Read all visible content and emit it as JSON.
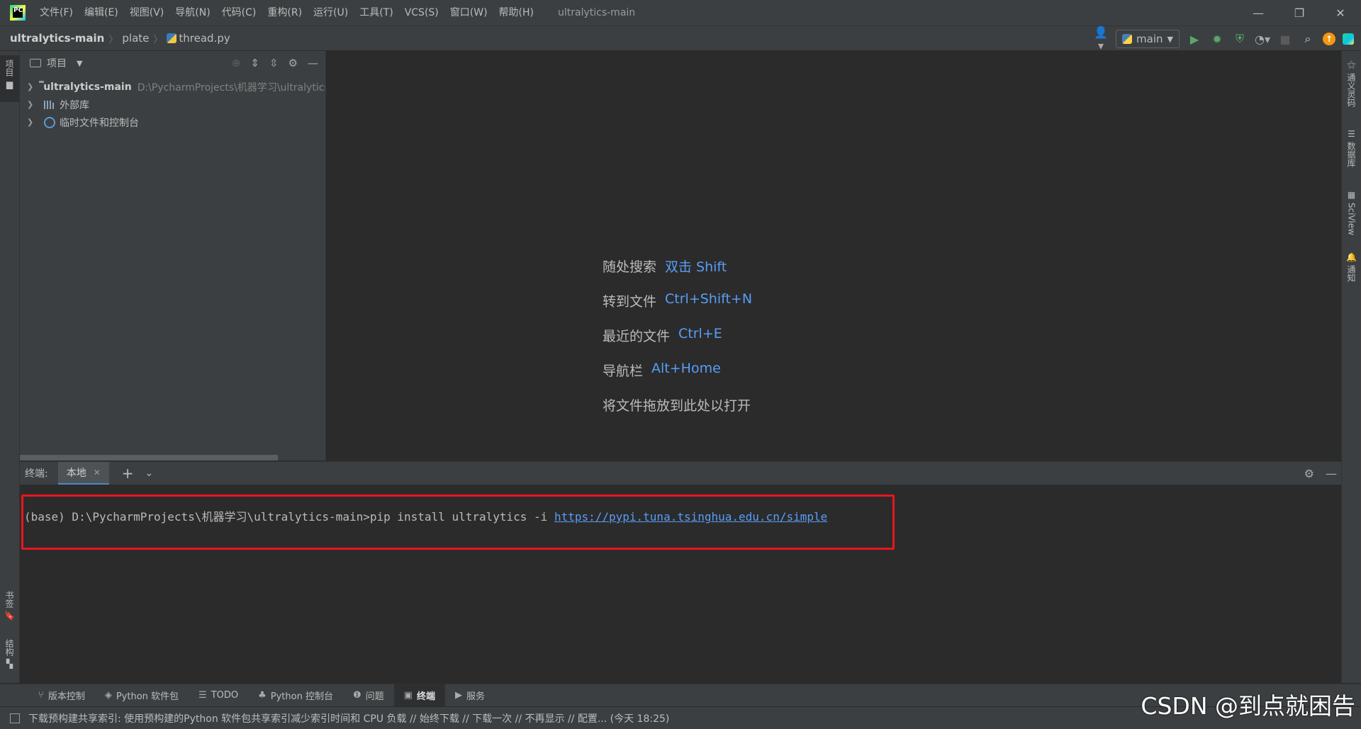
{
  "titlebar": {
    "menu": [
      "文件(F)",
      "编辑(E)",
      "视图(V)",
      "导航(N)",
      "代码(C)",
      "重构(R)",
      "运行(U)",
      "工具(T)",
      "VCS(S)",
      "窗口(W)",
      "帮助(H)"
    ],
    "window_title": "ultralytics-main",
    "minimize": "—",
    "restore": "❐",
    "close": "✕"
  },
  "breadcrumbs": [
    "ultralytics-main",
    "plate",
    "thread.py"
  ],
  "run_config": {
    "label": "main"
  },
  "left_stripe": {
    "project": "项目",
    "bookmarks": "书签",
    "structure": "结构"
  },
  "right_stripe": [
    "通义灵码",
    "数据库",
    "SciView",
    "通知"
  ],
  "project_panel": {
    "title": "项目",
    "tree": [
      {
        "label": "ultralytics-main",
        "path": "D:\\PycharmProjects\\机器学习\\ultralytics-main",
        "icon": "folder-icon"
      },
      {
        "label": "外部库",
        "icon": "library-icon"
      },
      {
        "label": "临时文件和控制台",
        "icon": "scratch-icon"
      }
    ]
  },
  "editor_hints": [
    {
      "label": "随处搜索",
      "key": "双击 Shift"
    },
    {
      "label": "转到文件",
      "key": "Ctrl+Shift+N"
    },
    {
      "label": "最近的文件",
      "key": "Ctrl+E"
    },
    {
      "label": "导航栏",
      "key": "Alt+Home"
    },
    {
      "label": "将文件拖放到此处以打开",
      "key": ""
    }
  ],
  "terminal": {
    "caption": "终端:",
    "tab": "本地",
    "command": "(base) D:\\PycharmProjects\\机器学习\\ultralytics-main>pip install ultralytics -i ",
    "link": "https://pypi.tuna.tsinghua.edu.cn/simple"
  },
  "tool_windows": [
    {
      "label": "版本控制",
      "icon": "branch-icon"
    },
    {
      "label": "Python 软件包",
      "icon": "packages-icon"
    },
    {
      "label": "TODO",
      "icon": "list-icon"
    },
    {
      "label": "Python 控制台",
      "icon": "python-icon"
    },
    {
      "label": "问题",
      "icon": "problems-icon"
    },
    {
      "label": "终端",
      "icon": "terminal-icon",
      "active": true
    },
    {
      "label": "服务",
      "icon": "services-icon"
    }
  ],
  "status": {
    "message": "下载预构建共享索引: 使用预构建的Python 软件包共享索引减少索引时间和 CPU 负载 // 始终下载 // 下载一次 // 不再显示 // 配置... (今天 18:25)"
  },
  "watermark": "CSDN @到点就困告",
  "colors": {
    "accent_link": "#589df6",
    "highlight_box": "#e8161c",
    "run_green": "#59a869",
    "update_orange": "#f49810"
  }
}
